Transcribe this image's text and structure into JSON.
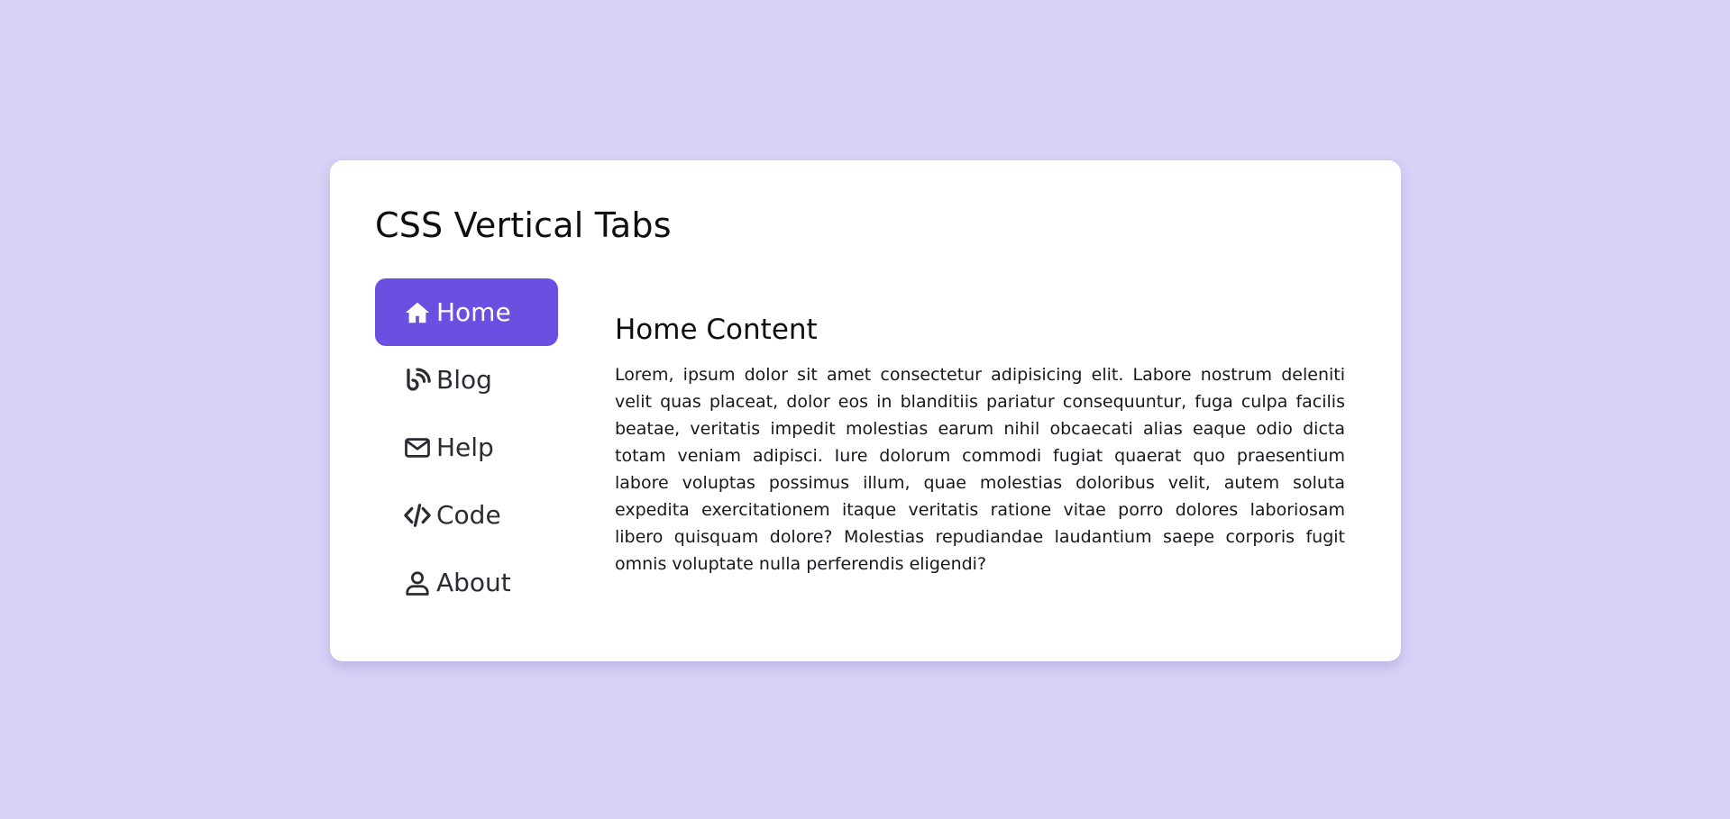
{
  "page": {
    "title": "CSS Vertical Tabs"
  },
  "tabs": [
    {
      "label": "Home",
      "icon": "home-icon",
      "active": true
    },
    {
      "label": "Blog",
      "icon": "blog-icon",
      "active": false
    },
    {
      "label": "Help",
      "icon": "envelope-icon",
      "active": false
    },
    {
      "label": "Code",
      "icon": "code-icon",
      "active": false
    },
    {
      "label": "About",
      "icon": "user-icon",
      "active": false
    }
  ],
  "content": {
    "title": "Home Content",
    "body": "Lorem, ipsum dolor sit amet consectetur adipisicing elit. Labore nostrum deleniti velit quas placeat, dolor eos in blanditiis pariatur consequuntur, fuga culpa facilis beatae, veritatis impedit molestias earum nihil obcaecati alias eaque odio dicta totam veniam adipisci. Iure dolorum commodi fugiat quaerat quo praesentium labore voluptas possimus illum, quae molestias doloribus velit, autem soluta expedita exercitationem itaque veritatis ratione vitae porro dolores laboriosam libero quisquam dolore? Molestias repudiandae laudantium saepe corporis fugit omnis voluptate nulla perferendis eligendi?"
  },
  "colors": {
    "background": "#d9d2f6",
    "card": "#ffffff",
    "accent": "#6b4fe0",
    "text": "#2b2b33"
  }
}
